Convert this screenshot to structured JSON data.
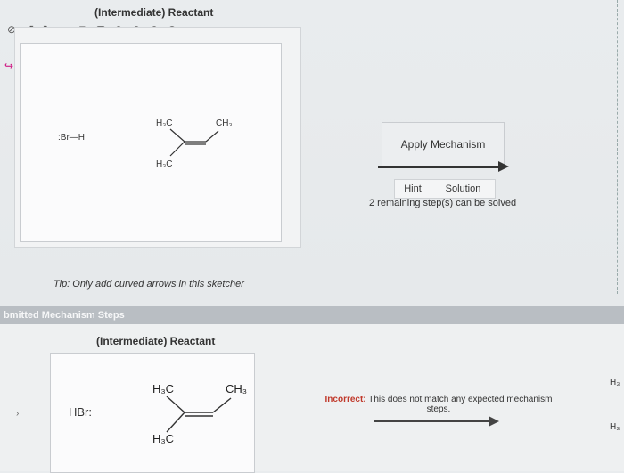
{
  "top_title": "(Intermediate) Reactant",
  "toolbar": {
    "icons": [
      "lasso-icon",
      "undo-icon",
      "redo-icon",
      "cut-icon",
      "copy-icon",
      "paste-icon",
      "zoom-fit-icon",
      "zoom-in-icon",
      "zoom-out-icon",
      "zoom-reset-icon"
    ]
  },
  "sketch": {
    "hbr_top": ":Br—H",
    "h3c_top": "H₃C",
    "ch3_top": "CH₃",
    "h3c_bottom": "H₃C"
  },
  "apply_label": "Apply Mechanism",
  "hint_label": "Hint",
  "solution_label": "Solution",
  "remaining_text": "2 remaining step(s) can be solved",
  "tip_text": "Tip: Only add curved arrows in this sketcher",
  "section_title": "bmitted Mechanism Steps",
  "submitted": {
    "title": "(Intermediate) Reactant",
    "hbr": "HBr:",
    "h3c_top": "H₃C",
    "ch3_top": "CH₃",
    "h3c_bottom": "H₃C",
    "incorrect_label": "Incorrect:",
    "incorrect_text": "This does not match any expected mechanism steps."
  },
  "right_frags": [
    "H₃",
    "H₃"
  ]
}
